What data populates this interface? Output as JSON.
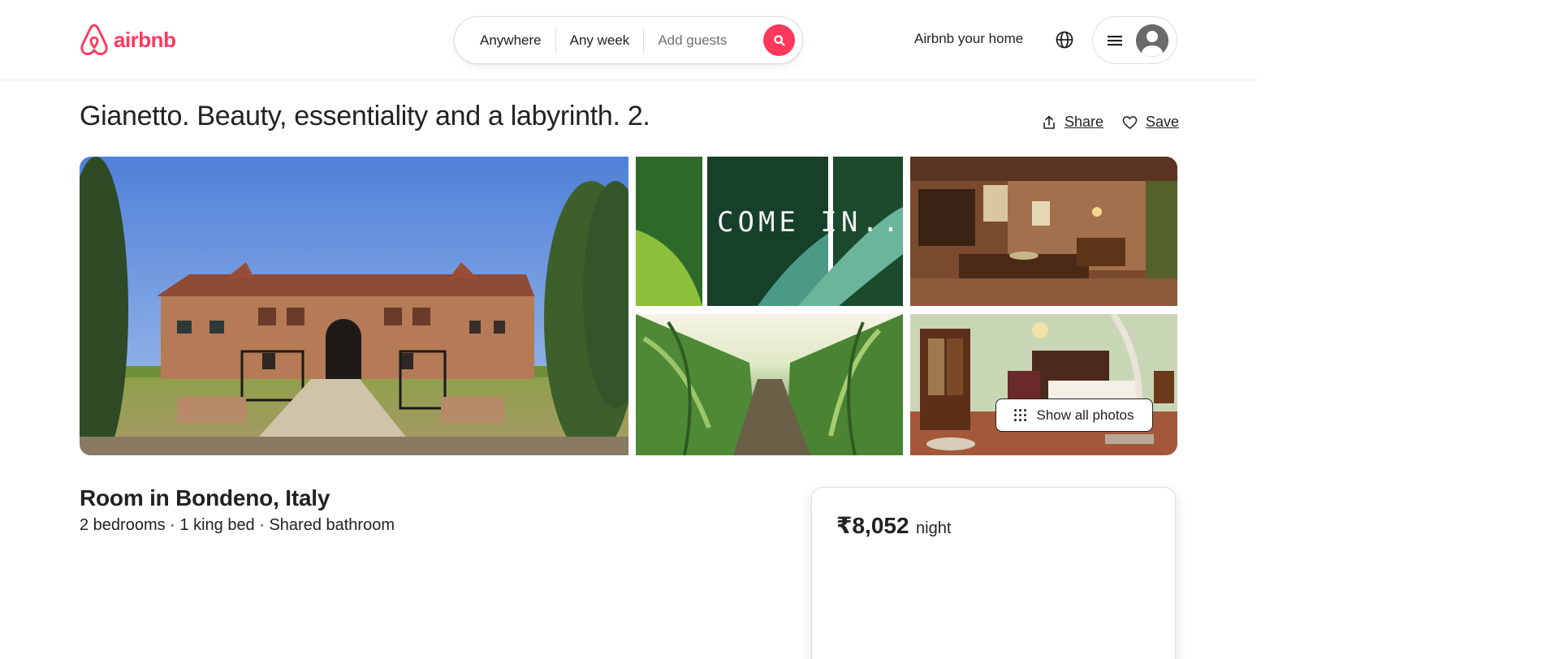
{
  "header": {
    "logo_text": "airbnb",
    "search": {
      "anywhere": "Anywhere",
      "any_week": "Any week",
      "add_guests": "Add guests"
    },
    "host_link": "Airbnb your home"
  },
  "listing": {
    "title": "Gianetto. Beauty, essentiality and a labyrinth. 2.",
    "share_label": "Share",
    "save_label": "Save",
    "photo_text": "COME IN...",
    "show_all_photos": "Show all photos",
    "room_type": "Room in Bondeno, Italy",
    "details": "2 bedrooms · 1 king bed · Shared bathroom",
    "price": "₹8,052",
    "price_unit": "night"
  },
  "colors": {
    "brand": "#ff385c",
    "text": "#222222",
    "muted": "#717171",
    "border": "#dddddd"
  },
  "icons": [
    "airbnb-logo-icon",
    "search-icon",
    "globe-icon",
    "menu-icon",
    "user-avatar-icon",
    "share-icon",
    "heart-icon",
    "grid-dots-icon"
  ]
}
